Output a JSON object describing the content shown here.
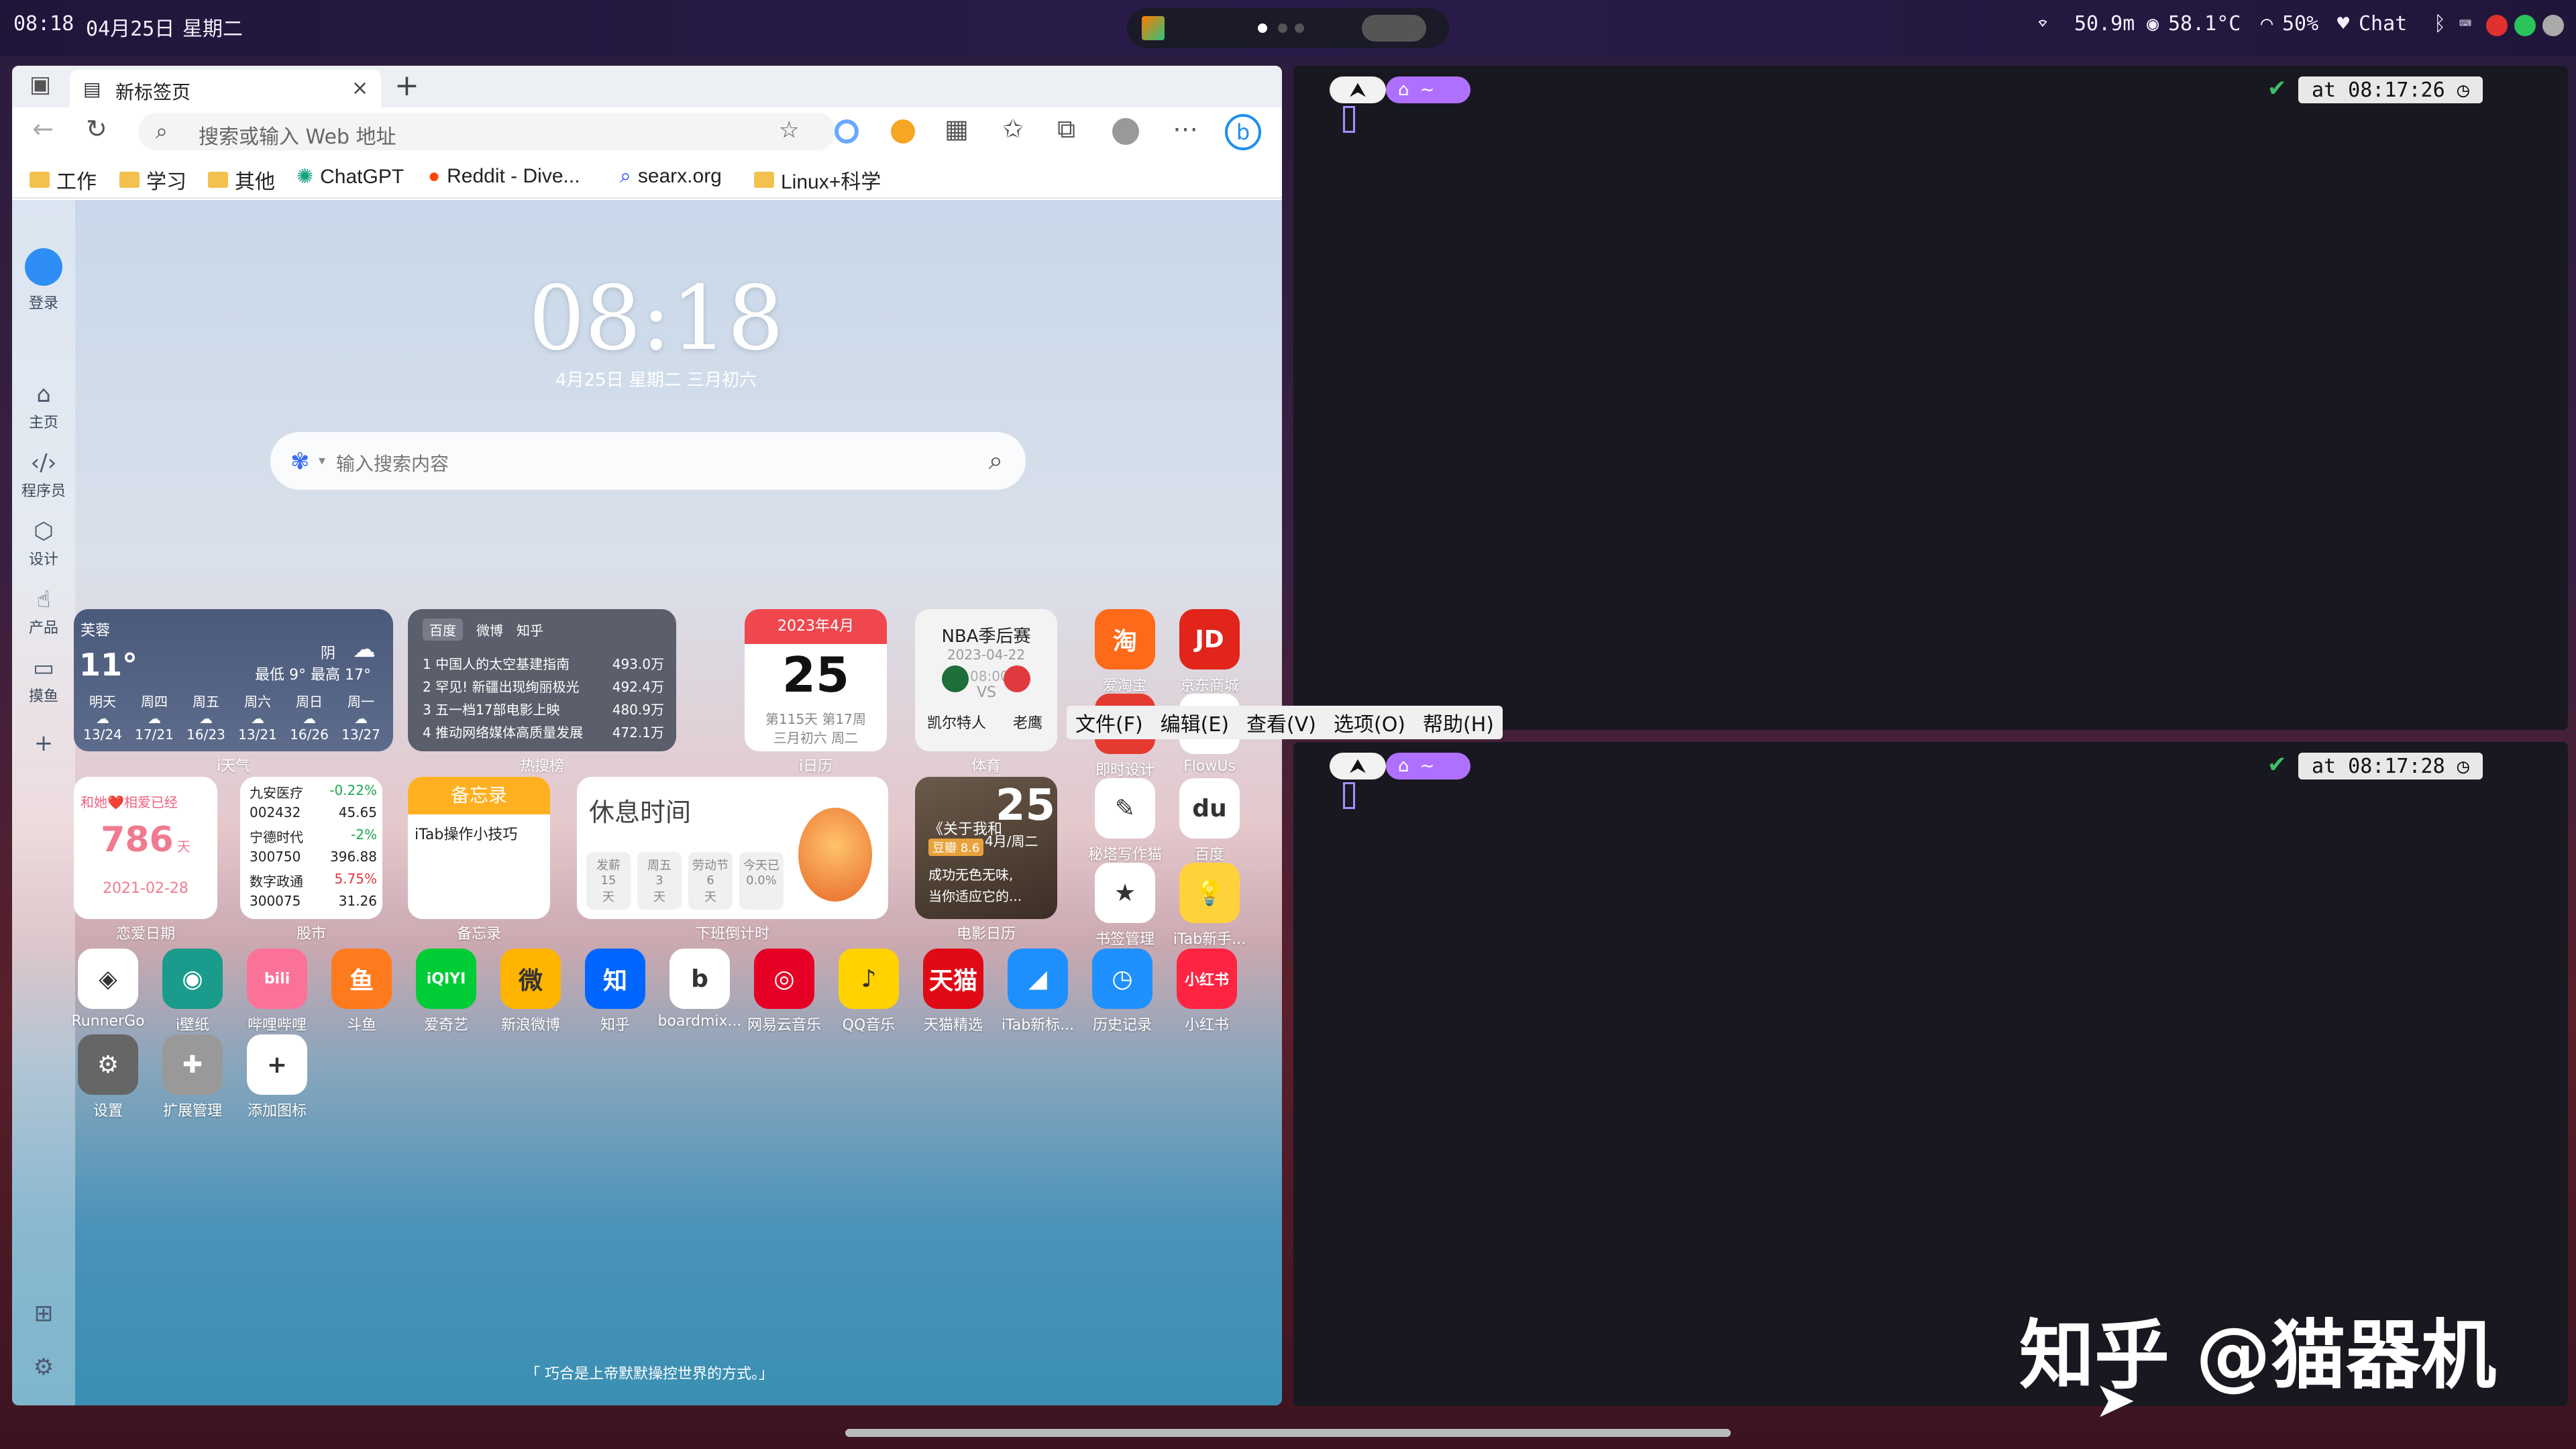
{
  "topbar": {
    "time": "08:18",
    "date": "04月25日",
    "weekday": "星期二",
    "network": "50.9m",
    "temp": "58.1°C",
    "volume": "50%",
    "chat": "Chat"
  },
  "browser": {
    "tab_title": "新标签页",
    "url_placeholder": "搜索或输入 Web 地址",
    "bookmarks": [
      "工作",
      "学习",
      "其他",
      "ChatGPT",
      "Reddit - Dive...",
      "searx.org",
      "Linux+科学"
    ]
  },
  "sidebar": {
    "items": [
      {
        "label": "登录"
      },
      {
        "label": "主页"
      },
      {
        "label": "程序员"
      },
      {
        "label": "设计"
      },
      {
        "label": "产品"
      },
      {
        "label": "摸鱼"
      }
    ]
  },
  "newtab": {
    "clock": "08:18",
    "date": "4月25日  星期二  三月初六",
    "search_placeholder": "输入搜索内容",
    "quote": "「 巧合是上帝默默操控世界的方式。」"
  },
  "weather": {
    "city": "芙蓉",
    "temp": "11°",
    "condition": "阴",
    "range": "最低 9°  最高 17°",
    "days": [
      {
        "d": "明天",
        "t": "13/24"
      },
      {
        "d": "周四",
        "t": "17/21"
      },
      {
        "d": "周五",
        "t": "16/23"
      },
      {
        "d": "周六",
        "t": "13/21"
      },
      {
        "d": "周日",
        "t": "16/26"
      },
      {
        "d": "周一",
        "t": "13/27"
      }
    ],
    "label": "i天气"
  },
  "hot": {
    "tabs": [
      "百度",
      "微博",
      "知乎"
    ],
    "items": [
      {
        "t": "1  中国人的太空基建指南",
        "v": "493.0万"
      },
      {
        "t": "2  罕见! 新疆出现绚丽极光",
        "v": "492.4万"
      },
      {
        "t": "3  五一档17部电影上映",
        "v": "480.9万"
      },
      {
        "t": "4  推动网络媒体高质量发展",
        "v": "472.1万"
      }
    ],
    "label": "热搜榜"
  },
  "calendar": {
    "month": "2023年4月",
    "day": "25",
    "sub1": "第115天 第17周",
    "sub2": "三月初六 周二",
    "label": "i日历"
  },
  "nba": {
    "title": "NBA季后赛",
    "date": "2023-04-22",
    "time": "08:00:00",
    "vs": "VS",
    "team1": "凯尔特人",
    "team2": "老鹰",
    "label": "体育"
  },
  "love": {
    "title": "和她❤️相爱已经",
    "days": "786",
    "unit": "天",
    "date": "2021-02-28",
    "label": "恋爱日期"
  },
  "stocks": {
    "rows": [
      {
        "n": "九安医疗",
        "v": "-0.22%"
      },
      {
        "n": "002432",
        "v": "45.65"
      },
      {
        "n": "宁德时代",
        "v": "-2%"
      },
      {
        "n": "300750",
        "v": "396.88"
      },
      {
        "n": "数字政通",
        "v": "5.75%"
      },
      {
        "n": "300075",
        "v": "31.26"
      }
    ],
    "label": "股市"
  },
  "memo": {
    "title": "备忘录",
    "content": "iTab操作小技巧",
    "label": "备忘录"
  },
  "rest": {
    "title": "休息时间",
    "chips": [
      {
        "a": "发薪",
        "b": "15",
        "c": "天"
      },
      {
        "a": "周五",
        "b": "3",
        "c": "天"
      },
      {
        "a": "劳动节",
        "b": "6",
        "c": "天"
      },
      {
        "a": "今天已",
        "b": "0.0%",
        "c": ""
      }
    ],
    "label": "下班倒计时"
  },
  "movie": {
    "big": "25",
    "sub": "4月/周二",
    "title": "《关于我和",
    "score": "豆瓣 8.6",
    "desc1": "成功无色无味,",
    "desc2": "当你适应它的...",
    "label": "电影日历"
  },
  "apps_right": [
    {
      "label": "爱淘宝",
      "glyph": "淘",
      "color": "#ff6a1a"
    },
    {
      "label": "京东商城",
      "glyph": "JD",
      "color": "#e1251b"
    },
    {
      "label": "即时设计",
      "glyph": "◆",
      "color": "#e43a2f"
    },
    {
      "label": "FlowUs",
      "glyph": "▲",
      "color": "#ffffff"
    },
    {
      "label": "秘塔写作猫",
      "glyph": "✎",
      "color": "#ffffff"
    },
    {
      "label": "百度",
      "glyph": "du",
      "color": "#ffffff"
    },
    {
      "label": "书签管理",
      "glyph": "★",
      "color": "#ffffff"
    },
    {
      "label": "iTab新手...",
      "glyph": "💡",
      "color": "#ffd23c"
    }
  ],
  "apps_row": [
    {
      "label": "RunnerGo",
      "glyph": "◈",
      "color": "#ffffff"
    },
    {
      "label": "i壁纸",
      "glyph": "◉",
      "color": "#1b9b8c"
    },
    {
      "label": "哔哩哔哩",
      "glyph": "bili",
      "color": "#fb7299"
    },
    {
      "label": "斗鱼",
      "glyph": "鱼",
      "color": "#ff7a1c"
    },
    {
      "label": "爱奇艺",
      "glyph": "iQIYI",
      "color": "#00cc36"
    },
    {
      "label": "新浪微博",
      "glyph": "微",
      "color": "#ffb400"
    },
    {
      "label": "知乎",
      "glyph": "知",
      "color": "#0066ff"
    },
    {
      "label": "boardmix...",
      "glyph": "b",
      "color": "#ffffff"
    },
    {
      "label": "网易云音乐",
      "glyph": "◎",
      "color": "#e60026"
    },
    {
      "label": "QQ音乐",
      "glyph": "♪",
      "color": "#ffd200"
    },
    {
      "label": "天猫精选",
      "glyph": "天猫",
      "color": "#e00a17"
    },
    {
      "label": "iTab新标...",
      "glyph": "◢",
      "color": "#1e8fff"
    },
    {
      "label": "历史记录",
      "glyph": "◷",
      "color": "#1e90ff"
    },
    {
      "label": "小红书",
      "glyph": "小红书",
      "color": "#ff2442"
    }
  ],
  "apps_row2": [
    {
      "label": "设置",
      "glyph": "⚙",
      "color": "#666666"
    },
    {
      "label": "扩展管理",
      "glyph": "✚",
      "color": "#999999"
    },
    {
      "label": "添加图标",
      "glyph": "+",
      "color": "#ffffff"
    }
  ],
  "terminal": {
    "home": "~",
    "ts1": "at 08:17:26",
    "ts2": "at 08:17:28"
  },
  "menu": {
    "items": [
      "文件(F)",
      "编辑(E)",
      "查看(V)",
      "选项(O)",
      "帮助(H)"
    ]
  },
  "watermark": "知乎 @猫器机"
}
